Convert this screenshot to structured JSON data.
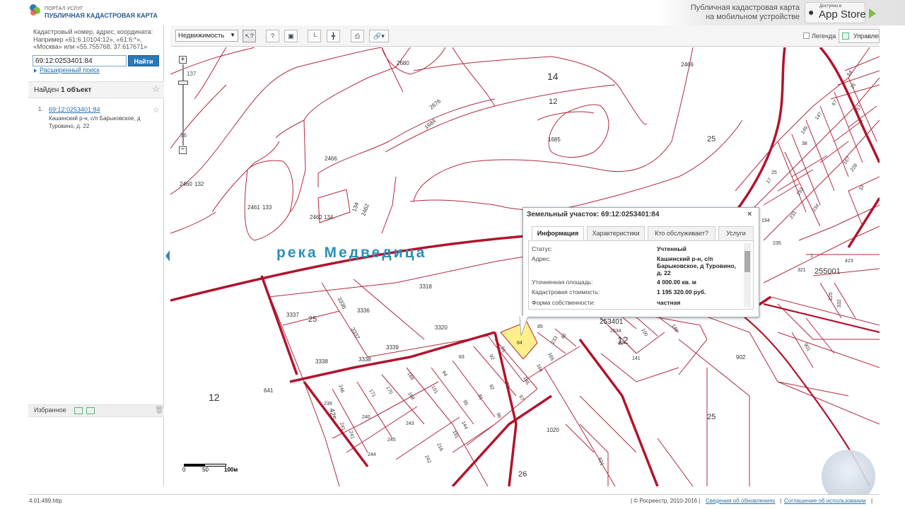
{
  "header": {
    "logo_small": "ПОРТАЛ УСЛУГ",
    "logo_big": "ПУБЛИЧНАЯ КАДАСТРОВАЯ КАРТА",
    "promo_text": "Публичная кадастровая карта на мобильном устройстве",
    "appstore_small": "Доступно в",
    "appstore_big": "App Store"
  },
  "search": {
    "hint": "Кадастровый номер, адрес, координата: Например «61:6.10104:12», «61:6:*», «Москва» или «55.755768, 37.617671»",
    "value": "69:12:0253401:84",
    "button": "Найти",
    "advanced": "Расширенный поиск"
  },
  "results": {
    "found_prefix": "Найден",
    "found_bold": "1 объект",
    "items": [
      {
        "num": "1.",
        "link": "69:12:0253401:84",
        "address": "Кашинский р-н, с/п Барыковское, д Туровино, д. 22"
      }
    ]
  },
  "favorites": {
    "label": "Избранное"
  },
  "toolbar": {
    "select_value": "Недвижимость",
    "legend": "Легенда",
    "manage": "Управление"
  },
  "map": {
    "river_name": "река Медведица",
    "scale_labels": [
      "0",
      "50",
      "100м"
    ],
    "zoom_ticks": [
      "137",
      "16"
    ],
    "plot_labels": [
      "14",
      "12",
      "2466",
      "2680",
      "2676",
      "1684",
      "1685",
      "2466",
      "2460",
      "132",
      "2461",
      "133",
      "2462",
      "134",
      "134",
      "2462",
      "25",
      "3337",
      "3336",
      "3336",
      "3337",
      "3318",
      "3320",
      "3339",
      "3338",
      "3338",
      "83",
      "84",
      "85",
      "91",
      "92",
      "94",
      "101",
      "169",
      "168",
      "170",
      "171",
      "246",
      "239",
      "240",
      "241",
      "241",
      "243",
      "245",
      "244",
      "242",
      "216",
      "191",
      "144",
      "95",
      "81",
      "82",
      "72",
      "97",
      "96",
      "145",
      "164",
      "165",
      "233",
      "46",
      "12",
      "641",
      "12",
      "1020",
      "821",
      "26",
      "25",
      "902",
      "141",
      "12",
      "25",
      "100",
      "146",
      "901",
      "321",
      "1",
      "423",
      "255001",
      "332",
      "225",
      "38",
      "64",
      "16",
      "67",
      "257",
      "147",
      "149",
      "167",
      "228",
      "25",
      "17",
      "193",
      "231",
      "234",
      "235",
      "194",
      "33",
      "425",
      "253401",
      "2534",
      "34"
    ]
  },
  "popup": {
    "title": "Земельный участок: 69:12:0253401:84",
    "tabs": [
      "Информация",
      "Характеристики",
      "Кто обслуживает?",
      "Услуги"
    ],
    "props": [
      {
        "label": "Статус:",
        "value": "Учтенный"
      },
      {
        "label": "Адрес:",
        "value": "Кашинский р-н, с/п Барыковское, д Туровино, д. 22"
      },
      {
        "label": "Уточненная площадь:",
        "value": "4 000.00 кв. м"
      },
      {
        "label": "Кадастровая стоимость:",
        "value": "1 195 320.00 руб."
      },
      {
        "label": "Форма собственности:",
        "value": "частная"
      }
    ]
  },
  "footer": {
    "version": "4.01.499.http",
    "copyright": "| © Росреестр, 2010-2016 |",
    "link1": "Сведения об обновлениях",
    "sep": "|",
    "link2": "Соглашение об использовании",
    "end": "|"
  },
  "colors": {
    "boundary": "#a3122a",
    "accent": "#2b7ab8",
    "river_text": "#2d8fb8",
    "selected_plot": "#ffef8a"
  }
}
